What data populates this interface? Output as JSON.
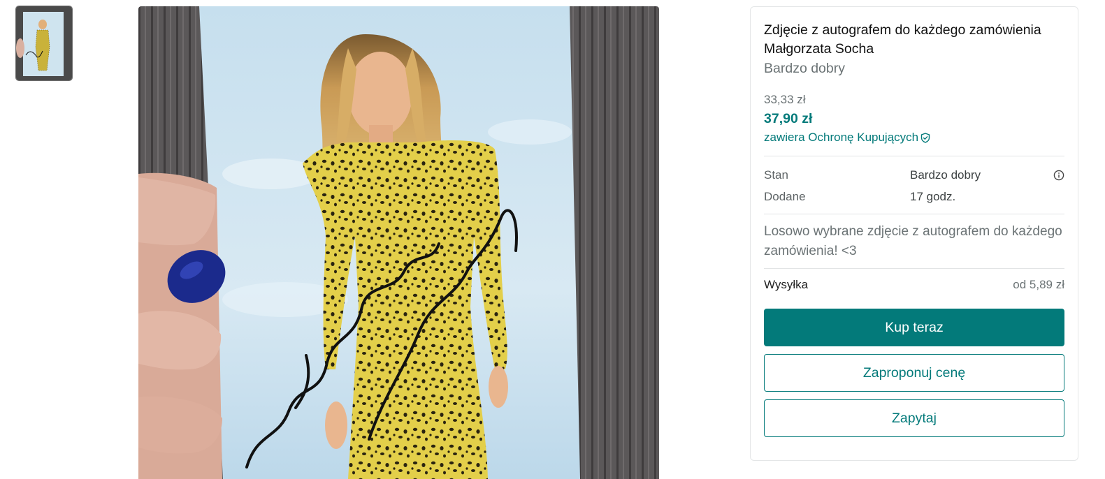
{
  "item": {
    "title": "Zdjęcie z autografem do każdego zamówienia Małgorzata Socha",
    "condition": "Bardzo dobry",
    "price_original": "33,33 zł",
    "price_total": "37,90 zł",
    "protection_text": "zawiera Ochronę Kupujących",
    "description": "Losowo wybrane zdjęcie z autografem do każdego zamówienia! <3"
  },
  "details": [
    {
      "label": "Stan",
      "value": "Bardzo dobry",
      "icon": "info-icon"
    },
    {
      "label": "Dodane",
      "value": "17 godz."
    }
  ],
  "shipping": {
    "label": "Wysyłka",
    "value": "od 5,89 zł"
  },
  "actions": {
    "buy_now": "Kup teraz",
    "make_offer": "Zaproponuj cenę",
    "ask": "Zapytaj"
  },
  "colors": {
    "accent": "#037a7a",
    "muted_text": "#6b7375"
  },
  "photo": {
    "subject": "autographed photo of a woman in a leopard print dress held in a hand against wooden decking"
  }
}
